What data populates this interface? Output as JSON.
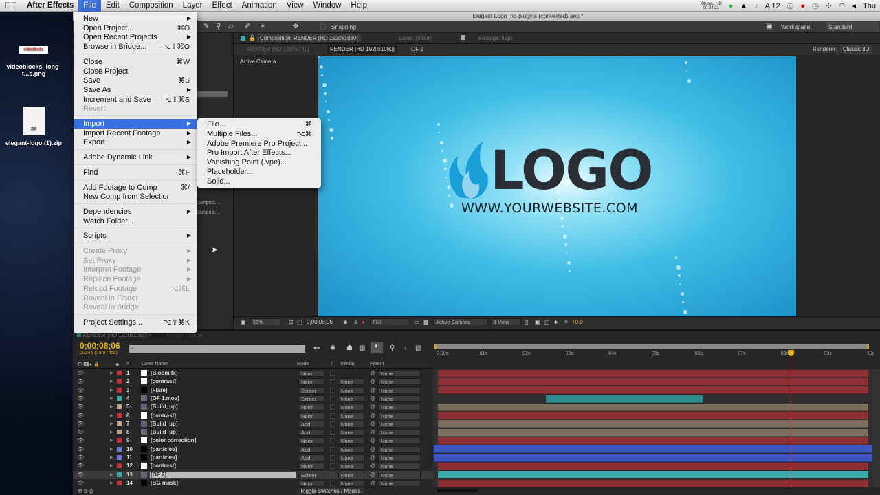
{
  "menubar": {
    "app": "After Effects",
    "items": [
      "File",
      "Edit",
      "Composition",
      "Layer",
      "Effect",
      "Animation",
      "View",
      "Window",
      "Help"
    ],
    "active": "File",
    "status": {
      "ishowu": "iShowU HD",
      "ishowu_time": "00:04:21",
      "badge": "12",
      "day": "Thu"
    }
  },
  "desktop": {
    "icons": [
      {
        "label": "videoblocks_long-t...s.png",
        "thumb": "videoblocks"
      },
      {
        "label": "elegant-logo (1).zip",
        "thumb": "ZIP"
      }
    ]
  },
  "window": {
    "title": "Elegant Logo_no plugins (converted).aep *"
  },
  "toolbar": {
    "snapping": "Snapping",
    "workspace_label": "Workspace:",
    "workspace": "Standard"
  },
  "viewer_tabs": {
    "composition": "Composition: RENDER [HD 1920x1080]",
    "layer": "Layer: (none)",
    "footage": "Footage: logo"
  },
  "comp_sub": {
    "items": [
      "RENDER [HD 1280x720]",
      "RENDER [HD 1920x1080]",
      "OF 2"
    ],
    "renderer_label": "Renderer:",
    "renderer": "Classic 3D"
  },
  "viewer": {
    "camera_label": "Active Camera",
    "logo_text": "LOGO",
    "website": "WWW.YOURWEBSITE.COM"
  },
  "comp_footer": {
    "zoom": "50%",
    "timecode": "0;00;08;06",
    "resolution": "Full",
    "view": "Active Camera",
    "layout": "1 View",
    "exposure": "+0.0"
  },
  "project": {
    "items": [
      "Composi...",
      "Composi..."
    ]
  },
  "timeline": {
    "tab": "RENDER [HD 1920x1080]",
    "tab2": "Render Queue",
    "timecode": "0;00;08;06",
    "frames": "00246 (29.97 fps)",
    "search_placeholder": "⌕▾",
    "headers": {
      "name": "Layer Name",
      "mode": "Mode",
      "t": "T",
      "trkmat": "TrkMat",
      "parent": "Parent",
      "num": "#"
    },
    "ruler": [
      "0:00s",
      "01s",
      "02s",
      "03s",
      "04s",
      "05s",
      "06s",
      "07s",
      "08s",
      "09s",
      "10s"
    ],
    "duration_s": 10,
    "current_time_s": 8.2,
    "toggle": "Toggle Switches / Modes",
    "layers": [
      {
        "n": "1",
        "name": "[Bloom fx]",
        "mode": "Norm",
        "trkmat": "",
        "parent": "None",
        "label": "#c8313b",
        "src": "white",
        "bar": "#8e2f36",
        "start": 0,
        "end": 10
      },
      {
        "n": "2",
        "name": "[contrast]",
        "mode": "Norm",
        "trkmat": "None",
        "parent": "None",
        "label": "#c8313b",
        "src": "white",
        "bar": "#8e2f36",
        "start": 0,
        "end": 10
      },
      {
        "n": "3",
        "name": "[Flare]",
        "mode": "Screer",
        "trkmat": "None",
        "parent": "None",
        "label": "#c8313b",
        "src": "black",
        "bar": "#8e2f36",
        "start": 0,
        "end": 10
      },
      {
        "n": "4",
        "name": "[OF 1.mov]",
        "mode": "Screer",
        "trkmat": "None",
        "parent": "None",
        "label": "#3aa6a0",
        "src": "file",
        "bar": "#2d8c8e",
        "start": 2.5,
        "end": 6.15
      },
      {
        "n": "5",
        "name": "[Build_up]",
        "mode": "Norm",
        "trkmat": "None",
        "parent": "None",
        "label": "#bba38a",
        "src": "comp",
        "bar": "#7c6f5d",
        "start": 0,
        "end": 10
      },
      {
        "n": "6",
        "name": "[contrast]",
        "mode": "Norm",
        "trkmat": "None",
        "parent": "None",
        "label": "#c8313b",
        "src": "white",
        "bar": "#8e2f36",
        "start": 0,
        "end": 10
      },
      {
        "n": "7",
        "name": "[Build_up]",
        "mode": "Add",
        "trkmat": "None",
        "parent": "None",
        "label": "#bba38a",
        "src": "comp",
        "bar": "#7c6f5d",
        "start": 0,
        "end": 10
      },
      {
        "n": "8",
        "name": "[Build_up]",
        "mode": "Add",
        "trkmat": "None",
        "parent": "None",
        "label": "#bba38a",
        "src": "comp",
        "bar": "#7c6f5d",
        "start": 0,
        "end": 10
      },
      {
        "n": "9",
        "name": "[color correction]",
        "mode": "Norm",
        "trkmat": "None",
        "parent": "None",
        "label": "#c8313b",
        "src": "white",
        "bar": "#8e2f36",
        "start": 0,
        "end": 10
      },
      {
        "n": "10",
        "name": "[particles]",
        "mode": "Add",
        "trkmat": "None",
        "parent": "None",
        "label": "#6f78e0",
        "src": "black",
        "bar": "#3d55c0",
        "start": -0.1,
        "end": 10.1
      },
      {
        "n": "11",
        "name": "[particles]",
        "mode": "Add",
        "trkmat": "None",
        "parent": "None",
        "label": "#6f78e0",
        "src": "black",
        "bar": "#3d55c0",
        "start": -0.1,
        "end": 10.1
      },
      {
        "n": "12",
        "name": "[contrast]",
        "mode": "Norm",
        "trkmat": "None",
        "parent": "None",
        "label": "#c8313b",
        "src": "white",
        "bar": "#8e2f36",
        "start": 0,
        "end": 10
      },
      {
        "n": "13",
        "name": "[OF 2]",
        "mode": "Screer",
        "trkmat": "None",
        "parent": "None",
        "label": "#3aa6a0",
        "src": "comp",
        "bar": "#3aa8aa",
        "start": 0,
        "end": 10,
        "selected": true
      },
      {
        "n": "14",
        "name": "[BG mask]",
        "mode": "Norm",
        "trkmat": "None",
        "parent": "None",
        "label": "#c8313b",
        "src": "black",
        "bar": "#8e2f36",
        "start": 0,
        "end": 10
      }
    ]
  },
  "file_menu": {
    "items": [
      {
        "label": "New",
        "arrow": true
      },
      {
        "label": "Open Project...",
        "sc": "⌘O"
      },
      {
        "label": "Open Recent Projects",
        "arrow": true
      },
      {
        "label": "Browse in Bridge...",
        "sc": "⌥⇧⌘O"
      },
      {
        "sep": true
      },
      {
        "label": "Close",
        "sc": "⌘W"
      },
      {
        "label": "Close Project"
      },
      {
        "label": "Save",
        "sc": "⌘S"
      },
      {
        "label": "Save As",
        "arrow": true
      },
      {
        "label": "Increment and Save",
        "sc": "⌥⇧⌘S"
      },
      {
        "label": "Revert",
        "disabled": true
      },
      {
        "sep": true
      },
      {
        "label": "Import",
        "arrow": true,
        "highlighted": true
      },
      {
        "label": "Import Recent Footage",
        "arrow": true
      },
      {
        "label": "Export",
        "arrow": true
      },
      {
        "sep": true
      },
      {
        "label": "Adobe Dynamic Link",
        "arrow": true
      },
      {
        "sep": true
      },
      {
        "label": "Find",
        "sc": "⌘F"
      },
      {
        "sep": true
      },
      {
        "label": "Add Footage to Comp",
        "sc": "⌘/"
      },
      {
        "label": "New Comp from Selection"
      },
      {
        "sep": true
      },
      {
        "label": "Dependencies",
        "arrow": true
      },
      {
        "label": "Watch Folder..."
      },
      {
        "sep": true
      },
      {
        "label": "Scripts",
        "arrow": true
      },
      {
        "sep": true
      },
      {
        "label": "Create Proxy",
        "arrow": true,
        "disabled": true
      },
      {
        "label": "Set Proxy",
        "arrow": true,
        "disabled": true
      },
      {
        "label": "Interpret Footage",
        "arrow": true,
        "disabled": true
      },
      {
        "label": "Replace Footage",
        "arrow": true,
        "disabled": true
      },
      {
        "label": "Reload Footage",
        "sc": "⌥⌘L",
        "disabled": true
      },
      {
        "label": "Reveal in Finder",
        "disabled": true
      },
      {
        "label": "Reveal in Bridge",
        "disabled": true
      },
      {
        "sep": true
      },
      {
        "label": "Project Settings...",
        "sc": "⌥⇧⌘K"
      }
    ]
  },
  "import_menu": {
    "items": [
      {
        "label": "File...",
        "sc": "⌘I"
      },
      {
        "label": "Multiple Files...",
        "sc": "⌥⌘I"
      },
      {
        "label": "Adobe Premiere Pro Project..."
      },
      {
        "label": "Pro Import After Effects..."
      },
      {
        "label": "Vanishing Point (.vpe)..."
      },
      {
        "label": "Placeholder..."
      },
      {
        "label": "Solid..."
      }
    ]
  }
}
